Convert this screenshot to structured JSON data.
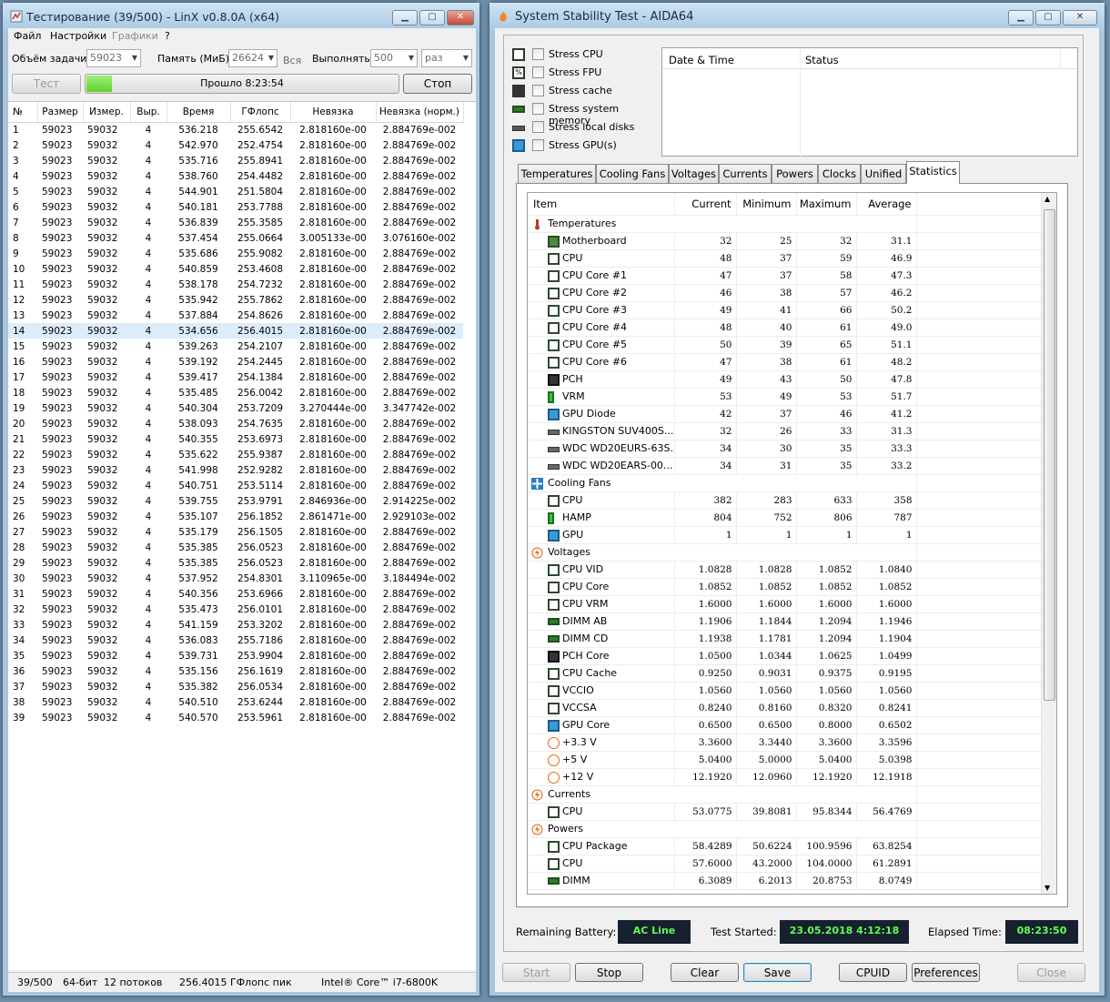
{
  "linx": {
    "title": "Тестирование (39/500) - LinX v0.8.0A (x64)",
    "menu": [
      "Файл",
      "Настройки",
      "Графики",
      "?"
    ],
    "task_size_label": "Объём задачи:",
    "task_size_value": "59023",
    "memory_label": "Память (МиБ):",
    "memory_value": "26624",
    "all_label": "Вся",
    "run_label": "Выполнять:",
    "run_value": "500",
    "run_unit": "раз",
    "test_button": "Тест",
    "elapsed": "Прошло 8:23:54",
    "stop_button": "Стоп",
    "columns": [
      "№",
      "Размер",
      "Измер.",
      "Выр.",
      "Время",
      "ГФлопс",
      "Невязка",
      "Невязка (норм.)"
    ],
    "selected_row": 14,
    "rows": [
      [
        "1",
        "59023",
        "59032",
        "4",
        "536.218",
        "255.6542",
        "2.818160e-00",
        "2.884769e-002"
      ],
      [
        "2",
        "59023",
        "59032",
        "4",
        "542.970",
        "252.4754",
        "2.818160e-00",
        "2.884769e-002"
      ],
      [
        "3",
        "59023",
        "59032",
        "4",
        "535.716",
        "255.8941",
        "2.818160e-00",
        "2.884769e-002"
      ],
      [
        "4",
        "59023",
        "59032",
        "4",
        "538.760",
        "254.4482",
        "2.818160e-00",
        "2.884769e-002"
      ],
      [
        "5",
        "59023",
        "59032",
        "4",
        "544.901",
        "251.5804",
        "2.818160e-00",
        "2.884769e-002"
      ],
      [
        "6",
        "59023",
        "59032",
        "4",
        "540.181",
        "253.7788",
        "2.818160e-00",
        "2.884769e-002"
      ],
      [
        "7",
        "59023",
        "59032",
        "4",
        "536.839",
        "255.3585",
        "2.818160e-00",
        "2.884769e-002"
      ],
      [
        "8",
        "59023",
        "59032",
        "4",
        "537.454",
        "255.0664",
        "3.005133e-00",
        "3.076160e-002"
      ],
      [
        "9",
        "59023",
        "59032",
        "4",
        "535.686",
        "255.9082",
        "2.818160e-00",
        "2.884769e-002"
      ],
      [
        "10",
        "59023",
        "59032",
        "4",
        "540.859",
        "253.4608",
        "2.818160e-00",
        "2.884769e-002"
      ],
      [
        "11",
        "59023",
        "59032",
        "4",
        "538.178",
        "254.7232",
        "2.818160e-00",
        "2.884769e-002"
      ],
      [
        "12",
        "59023",
        "59032",
        "4",
        "535.942",
        "255.7862",
        "2.818160e-00",
        "2.884769e-002"
      ],
      [
        "13",
        "59023",
        "59032",
        "4",
        "537.884",
        "254.8626",
        "2.818160e-00",
        "2.884769e-002"
      ],
      [
        "14",
        "59023",
        "59032",
        "4",
        "534.656",
        "256.4015",
        "2.818160e-00",
        "2.884769e-002"
      ],
      [
        "15",
        "59023",
        "59032",
        "4",
        "539.263",
        "254.2107",
        "2.818160e-00",
        "2.884769e-002"
      ],
      [
        "16",
        "59023",
        "59032",
        "4",
        "539.192",
        "254.2445",
        "2.818160e-00",
        "2.884769e-002"
      ],
      [
        "17",
        "59023",
        "59032",
        "4",
        "539.417",
        "254.1384",
        "2.818160e-00",
        "2.884769e-002"
      ],
      [
        "18",
        "59023",
        "59032",
        "4",
        "535.485",
        "256.0042",
        "2.818160e-00",
        "2.884769e-002"
      ],
      [
        "19",
        "59023",
        "59032",
        "4",
        "540.304",
        "253.7209",
        "3.270444e-00",
        "3.347742e-002"
      ],
      [
        "20",
        "59023",
        "59032",
        "4",
        "538.093",
        "254.7635",
        "2.818160e-00",
        "2.884769e-002"
      ],
      [
        "21",
        "59023",
        "59032",
        "4",
        "540.355",
        "253.6973",
        "2.818160e-00",
        "2.884769e-002"
      ],
      [
        "22",
        "59023",
        "59032",
        "4",
        "535.622",
        "255.9387",
        "2.818160e-00",
        "2.884769e-002"
      ],
      [
        "23",
        "59023",
        "59032",
        "4",
        "541.998",
        "252.9282",
        "2.818160e-00",
        "2.884769e-002"
      ],
      [
        "24",
        "59023",
        "59032",
        "4",
        "540.751",
        "253.5114",
        "2.818160e-00",
        "2.884769e-002"
      ],
      [
        "25",
        "59023",
        "59032",
        "4",
        "539.755",
        "253.9791",
        "2.846936e-00",
        "2.914225e-002"
      ],
      [
        "26",
        "59023",
        "59032",
        "4",
        "535.107",
        "256.1852",
        "2.861471e-00",
        "2.929103e-002"
      ],
      [
        "27",
        "59023",
        "59032",
        "4",
        "535.179",
        "256.1505",
        "2.818160e-00",
        "2.884769e-002"
      ],
      [
        "28",
        "59023",
        "59032",
        "4",
        "535.385",
        "256.0523",
        "2.818160e-00",
        "2.884769e-002"
      ],
      [
        "29",
        "59023",
        "59032",
        "4",
        "535.385",
        "256.0523",
        "2.818160e-00",
        "2.884769e-002"
      ],
      [
        "30",
        "59023",
        "59032",
        "4",
        "537.952",
        "254.8301",
        "3.110965e-00",
        "3.184494e-002"
      ],
      [
        "31",
        "59023",
        "59032",
        "4",
        "540.356",
        "253.6966",
        "2.818160e-00",
        "2.884769e-002"
      ],
      [
        "32",
        "59023",
        "59032",
        "4",
        "535.473",
        "256.0101",
        "2.818160e-00",
        "2.884769e-002"
      ],
      [
        "33",
        "59023",
        "59032",
        "4",
        "541.159",
        "253.3202",
        "2.818160e-00",
        "2.884769e-002"
      ],
      [
        "34",
        "59023",
        "59032",
        "4",
        "536.083",
        "255.7186",
        "2.818160e-00",
        "2.884769e-002"
      ],
      [
        "35",
        "59023",
        "59032",
        "4",
        "539.731",
        "253.9904",
        "2.818160e-00",
        "2.884769e-002"
      ],
      [
        "36",
        "59023",
        "59032",
        "4",
        "535.156",
        "256.1619",
        "2.818160e-00",
        "2.884769e-002"
      ],
      [
        "37",
        "59023",
        "59032",
        "4",
        "535.382",
        "256.0534",
        "2.818160e-00",
        "2.884769e-002"
      ],
      [
        "38",
        "59023",
        "59032",
        "4",
        "540.510",
        "253.6244",
        "2.818160e-00",
        "2.884769e-002"
      ],
      [
        "39",
        "59023",
        "59032",
        "4",
        "540.570",
        "253.5961",
        "2.818160e-00",
        "2.884769e-002"
      ]
    ],
    "status": [
      "39/500",
      "64-бит",
      "12 потоков",
      "256.4015 ГФлопс пик",
      "Intel® Core™ i7-6800K"
    ]
  },
  "aida": {
    "title": "System Stability Test - AIDA64",
    "stress": [
      "Stress CPU",
      "Stress FPU",
      "Stress cache",
      "Stress system memory",
      "Stress local disks",
      "Stress GPU(s)"
    ],
    "log_columns": [
      "Date & Time",
      "Status"
    ],
    "tabs": [
      "Temperatures",
      "Cooling Fans",
      "Voltages",
      "Currents",
      "Powers",
      "Clocks",
      "Unified",
      "Statistics"
    ],
    "active_tab": "Statistics",
    "stat_columns": [
      "Item",
      "Current",
      "Minimum",
      "Maximum",
      "Average"
    ],
    "groups": [
      {
        "name": "Temperatures",
        "icon": "thermometer-icon",
        "items": [
          {
            "name": "Motherboard",
            "icon": "motherboard-icon",
            "v": [
              "32",
              "25",
              "32",
              "31.1"
            ]
          },
          {
            "name": "CPU",
            "icon": "cpu-icon",
            "v": [
              "48",
              "37",
              "59",
              "46.9"
            ]
          },
          {
            "name": "CPU Core #1",
            "icon": "cpu-icon",
            "v": [
              "47",
              "37",
              "58",
              "47.3"
            ]
          },
          {
            "name": "CPU Core #2",
            "icon": "cpu-icon",
            "v": [
              "46",
              "38",
              "57",
              "46.2"
            ]
          },
          {
            "name": "CPU Core #3",
            "icon": "cpu-icon",
            "v": [
              "49",
              "41",
              "66",
              "50.2"
            ]
          },
          {
            "name": "CPU Core #4",
            "icon": "cpu-icon",
            "v": [
              "48",
              "40",
              "61",
              "49.0"
            ]
          },
          {
            "name": "CPU Core #5",
            "icon": "cpu-icon",
            "v": [
              "50",
              "39",
              "65",
              "51.1"
            ]
          },
          {
            "name": "CPU Core #6",
            "icon": "cpu-icon",
            "v": [
              "47",
              "38",
              "61",
              "48.2"
            ]
          },
          {
            "name": "PCH",
            "icon": "chip-icon",
            "v": [
              "49",
              "43",
              "50",
              "47.8"
            ]
          },
          {
            "name": "VRM",
            "icon": "vrm-icon",
            "v": [
              "53",
              "49",
              "53",
              "51.7"
            ]
          },
          {
            "name": "GPU Diode",
            "icon": "gpu-icon",
            "v": [
              "42",
              "37",
              "46",
              "41.2"
            ]
          },
          {
            "name": "KINGSTON SUV400S...",
            "icon": "disk-icon",
            "v": [
              "32",
              "26",
              "33",
              "31.3"
            ]
          },
          {
            "name": "WDC WD20EURS-63S...",
            "icon": "disk-icon",
            "v": [
              "34",
              "30",
              "35",
              "33.3"
            ]
          },
          {
            "name": "WDC WD20EARS-00...",
            "icon": "disk-icon",
            "v": [
              "34",
              "31",
              "35",
              "33.2"
            ]
          }
        ]
      },
      {
        "name": "Cooling Fans",
        "icon": "fan-icon",
        "items": [
          {
            "name": "CPU",
            "icon": "cpu-icon",
            "v": [
              "382",
              "283",
              "633",
              "358"
            ]
          },
          {
            "name": "HAMP",
            "icon": "vrm-icon",
            "v": [
              "804",
              "752",
              "806",
              "787"
            ]
          },
          {
            "name": "GPU",
            "icon": "gpu-icon",
            "v": [
              "1",
              "1",
              "1",
              "1"
            ]
          }
        ]
      },
      {
        "name": "Voltages",
        "icon": "bolt-icon",
        "items": [
          {
            "name": "CPU VID",
            "icon": "cpu-icon",
            "v": [
              "1.0828",
              "1.0828",
              "1.0852",
              "1.0840"
            ]
          },
          {
            "name": "CPU Core",
            "icon": "cpu-icon",
            "v": [
              "1.0852",
              "1.0852",
              "1.0852",
              "1.0852"
            ]
          },
          {
            "name": "CPU VRM",
            "icon": "cpu-icon",
            "v": [
              "1.6000",
              "1.6000",
              "1.6000",
              "1.6000"
            ]
          },
          {
            "name": "DIMM AB",
            "icon": "memory-icon",
            "v": [
              "1.1906",
              "1.1844",
              "1.2094",
              "1.1946"
            ]
          },
          {
            "name": "DIMM CD",
            "icon": "memory-icon",
            "v": [
              "1.1938",
              "1.1781",
              "1.2094",
              "1.1904"
            ]
          },
          {
            "name": "PCH Core",
            "icon": "chip-icon",
            "v": [
              "1.0500",
              "1.0344",
              "1.0625",
              "1.0499"
            ]
          },
          {
            "name": "CPU Cache",
            "icon": "cpu-icon",
            "v": [
              "0.9250",
              "0.9031",
              "0.9375",
              "0.9195"
            ]
          },
          {
            "name": "VCCIO",
            "icon": "cpu-icon",
            "v": [
              "1.0560",
              "1.0560",
              "1.0560",
              "1.0560"
            ]
          },
          {
            "name": "VCCSA",
            "icon": "cpu-icon",
            "v": [
              "0.8240",
              "0.8160",
              "0.8320",
              "0.8241"
            ]
          },
          {
            "name": "GPU Core",
            "icon": "gpu-icon",
            "v": [
              "0.6500",
              "0.6500",
              "0.8000",
              "0.6502"
            ]
          },
          {
            "name": "+3.3 V",
            "icon": "bolt-icon",
            "v": [
              "3.3600",
              "3.3440",
              "3.3600",
              "3.3596"
            ]
          },
          {
            "name": "+5 V",
            "icon": "bolt-icon",
            "v": [
              "5.0400",
              "5.0000",
              "5.0400",
              "5.0398"
            ]
          },
          {
            "name": "+12 V",
            "icon": "bolt-icon",
            "v": [
              "12.1920",
              "12.0960",
              "12.1920",
              "12.1918"
            ]
          }
        ]
      },
      {
        "name": "Currents",
        "icon": "bolt-icon",
        "items": [
          {
            "name": "CPU",
            "icon": "cpu-icon",
            "v": [
              "53.0775",
              "39.8081",
              "95.8344",
              "56.4769"
            ]
          }
        ]
      },
      {
        "name": "Powers",
        "icon": "bolt-icon",
        "items": [
          {
            "name": "CPU Package",
            "icon": "cpu-icon",
            "v": [
              "58.4289",
              "50.6224",
              "100.9596",
              "63.8254"
            ]
          },
          {
            "name": "CPU",
            "icon": "cpu-icon",
            "v": [
              "57.6000",
              "43.2000",
              "104.0000",
              "61.2891"
            ]
          },
          {
            "name": "DIMM",
            "icon": "memory-icon",
            "v": [
              "6.3089",
              "6.2013",
              "20.8753",
              "8.0749"
            ]
          }
        ]
      }
    ],
    "battery_label": "Remaining Battery:",
    "battery_value": "AC Line",
    "started_label": "Test Started:",
    "started_value": "23.05.2018 4:12:18",
    "elapsed_label": "Elapsed Time:",
    "elapsed_value": "08:23:50",
    "buttons": [
      "Start",
      "Stop",
      "Clear",
      "Save",
      "CPUID",
      "Preferences",
      "Close"
    ],
    "colors": {
      "status_bg": "#16202e",
      "status_fg": "#5cff4d",
      "progress": "#6ee03a"
    }
  }
}
